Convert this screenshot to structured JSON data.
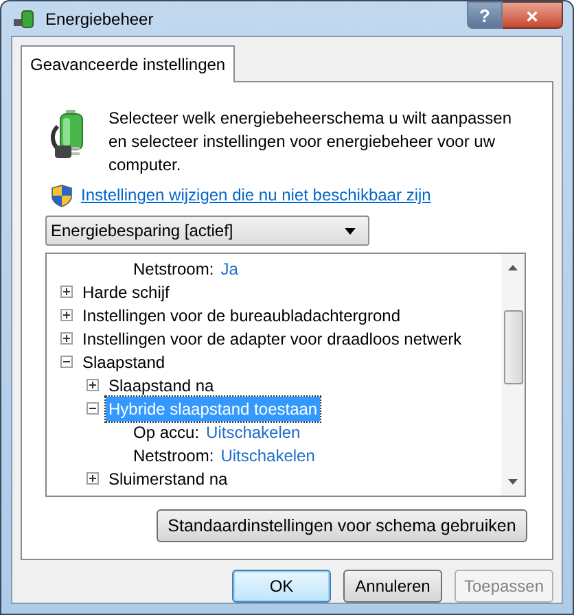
{
  "window": {
    "title": "Energiebeheer",
    "help": "?",
    "close": "×"
  },
  "tabs": [
    {
      "label": "Geavanceerde instellingen",
      "selected": true
    }
  ],
  "intro": "Selecteer welk energiebeheerschema u wilt aanpassen en selecteer instellingen voor energiebeheer voor uw computer.",
  "admin_link": "Instellingen wijzigen die nu niet beschikbaar zijn",
  "plan_select": {
    "value": "Energiebesparing [actief]"
  },
  "tree": [
    {
      "kind": "value",
      "label": "Netstroom:",
      "value": "Ja"
    },
    {
      "kind": "group",
      "label": "Harde schijf",
      "expanded": false,
      "selected": false
    },
    {
      "kind": "group",
      "label": "Instellingen voor de bureaubladachtergrond",
      "expanded": false,
      "selected": false
    },
    {
      "kind": "group",
      "label": "Instellingen voor de adapter voor draadloos netwerk",
      "expanded": false,
      "selected": false
    },
    {
      "kind": "group",
      "label": "Slaapstand",
      "expanded": true,
      "selected": false,
      "children": [
        {
          "kind": "group",
          "label": "Slaapstand na",
          "expanded": false,
          "selected": false
        },
        {
          "kind": "group",
          "label": "Hybride slaapstand toestaan",
          "expanded": true,
          "selected": true,
          "children": [
            {
              "kind": "value",
              "label": "Op accu:",
              "value": "Uitschakelen"
            },
            {
              "kind": "value",
              "label": "Netstroom:",
              "value": "Uitschakelen"
            }
          ]
        },
        {
          "kind": "group",
          "label": "Sluimerstand na",
          "expanded": false,
          "selected": false
        }
      ]
    }
  ],
  "restore_button": "Standaardinstellingen voor schema gebruiken",
  "buttons": [
    {
      "label": "OK",
      "kind": "default",
      "disabled": false
    },
    {
      "label": "Annuleren",
      "kind": "normal",
      "disabled": false
    },
    {
      "label": "Toepassen",
      "kind": "normal",
      "disabled": true
    }
  ]
}
